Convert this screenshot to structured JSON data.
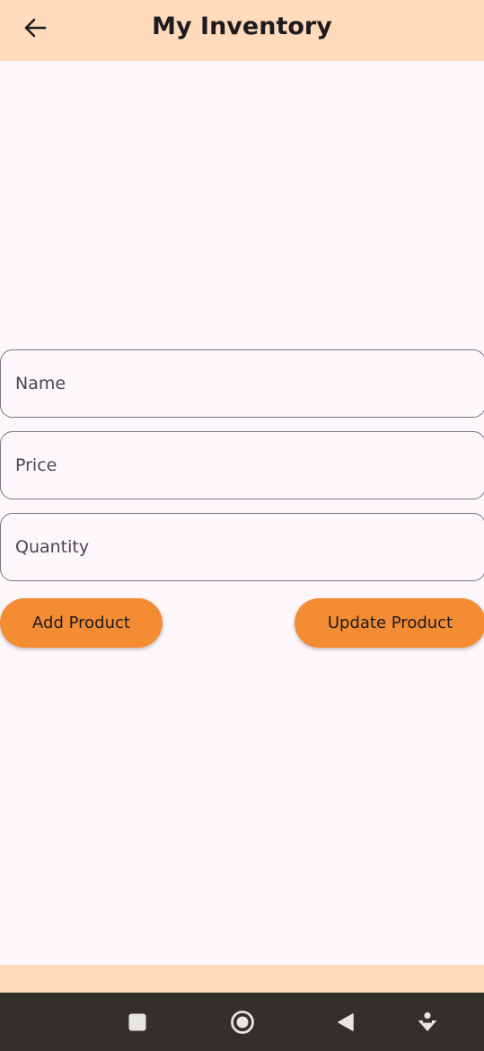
{
  "app_bar": {
    "title": "My Inventory",
    "background": "#ffdbbb",
    "back_icon": "arrow-left-icon"
  },
  "form": {
    "name": {
      "placeholder": "Name",
      "value": ""
    },
    "price": {
      "placeholder": "Price",
      "value": ""
    },
    "quantity": {
      "placeholder": "Quantity",
      "value": ""
    }
  },
  "actions": {
    "add_label": "Add Product",
    "update_label": "Update Product",
    "button_color": "#f38c32"
  },
  "system_nav": {
    "background": "#33302b",
    "icons": [
      "recent-apps-icon",
      "home-icon",
      "back-icon",
      "accessibility-icon"
    ]
  }
}
